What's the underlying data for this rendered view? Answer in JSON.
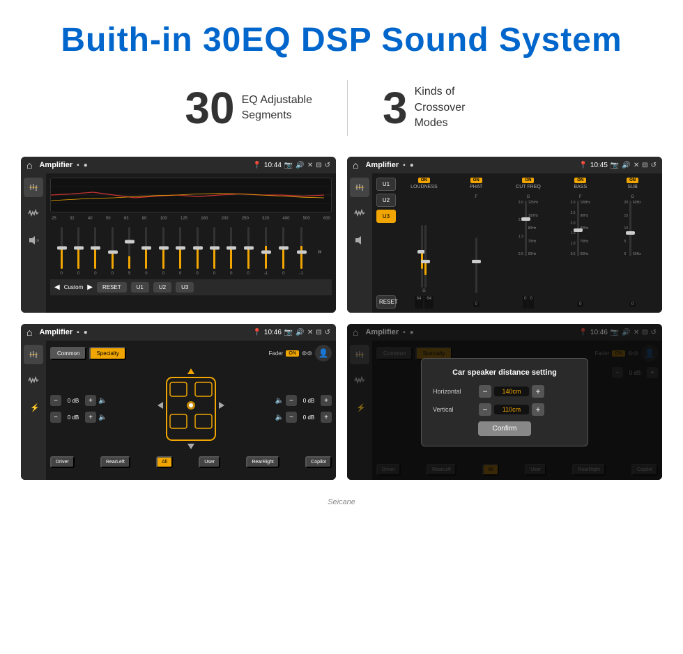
{
  "header": {
    "title": "Buith-in 30EQ DSP Sound System"
  },
  "stats": [
    {
      "number": "30",
      "label": "EQ Adjustable\nSegments"
    },
    {
      "number": "3",
      "label": "Kinds of\nCrossover Modes"
    }
  ],
  "screens": {
    "eq1": {
      "status": {
        "title": "Amplifier",
        "time": "10:44"
      },
      "freqs": [
        "25",
        "32",
        "40",
        "50",
        "63",
        "80",
        "100",
        "125",
        "160",
        "200",
        "250",
        "320",
        "400",
        "500",
        "630"
      ],
      "values": [
        "0",
        "0",
        "0",
        "0",
        "5",
        "0",
        "0",
        "0",
        "0",
        "0",
        "0",
        "0",
        "-1",
        "0",
        "-1"
      ],
      "buttons": [
        "Custom",
        "RESET",
        "U1",
        "U2",
        "U3"
      ],
      "preset_label": "Custom"
    },
    "crossover": {
      "status": {
        "title": "Amplifier",
        "time": "10:45"
      },
      "u_buttons": [
        "U1",
        "U2",
        "U3"
      ],
      "active_u": "U3",
      "channels": [
        "LOUDNESS",
        "PHAT",
        "CUT FREQ",
        "BASS",
        "SUB"
      ],
      "reset_label": "RESET"
    },
    "speaker": {
      "status": {
        "title": "Amplifier",
        "time": "10:46"
      },
      "buttons": [
        "Common",
        "Specialty"
      ],
      "active_btn": "Specialty",
      "fader_label": "Fader",
      "fader_on": "ON",
      "db_values": [
        "0 dB",
        "0 dB",
        "0 dB",
        "0 dB"
      ],
      "zone_buttons": [
        "Driver",
        "RearLeft",
        "All",
        "User",
        "RearRight",
        "Copilot"
      ],
      "active_zone": "All"
    },
    "dialog": {
      "status": {
        "title": "Amplifier",
        "time": "10:46"
      },
      "buttons": [
        "Common",
        "Specialty"
      ],
      "active_btn": "Specialty",
      "dialog": {
        "title": "Car speaker distance setting",
        "rows": [
          {
            "label": "Horizontal",
            "value": "140cm"
          },
          {
            "label": "Vertical",
            "value": "110cm"
          }
        ],
        "confirm_label": "Confirm"
      },
      "db_values": [
        "0 dB",
        "0 dB"
      ],
      "zone_buttons": [
        "Driver",
        "RearLeft",
        "All",
        "User",
        "RearRight",
        "Copilot"
      ]
    }
  },
  "watermark": "Seicane"
}
